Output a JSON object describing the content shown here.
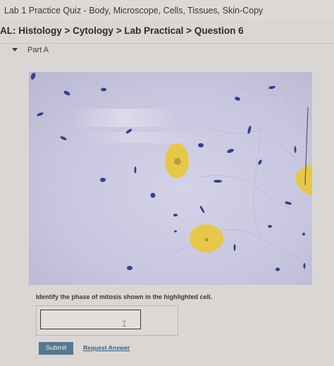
{
  "header": {
    "quiz_title": "Lab 1 Practice Quiz - Body, Microscope, Cells, Tissues, Skin-Copy",
    "breadcrumb": [
      "AL: Histology",
      "Cytology",
      "Lab Practical",
      "Question 6"
    ],
    "separator": ">"
  },
  "part": {
    "label": "Part A",
    "expanded": true
  },
  "question": {
    "prompt": "Identify the phase of mitosis shown in the highlighted cell.",
    "answer_value": "",
    "answer_placeholder": ""
  },
  "actions": {
    "submit_label": "Submit",
    "request_answer_label": "Request Answer"
  },
  "colors": {
    "background": "#d9d6d3",
    "highlight": "#e8c640",
    "submit": "#57778f",
    "link": "#3b5f80",
    "chromosome": "#3a3d8c",
    "tissue": "#c8c6df"
  }
}
